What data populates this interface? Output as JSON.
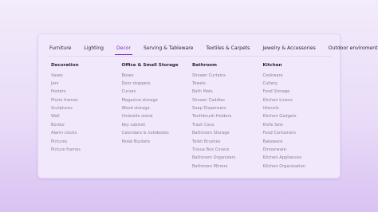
{
  "tabs": [
    {
      "label": "Furniture",
      "active": false
    },
    {
      "label": "Lighting",
      "active": false
    },
    {
      "label": "Decor",
      "active": true
    },
    {
      "label": "Serving & Tableware",
      "active": false
    },
    {
      "label": "Textiles & Carpets",
      "active": false
    },
    {
      "label": "Jewelry & Accessories",
      "active": false
    },
    {
      "label": "Outdoor enviroment",
      "active": false
    }
  ],
  "columns": [
    {
      "title": "Decoration",
      "items": [
        "Vases",
        "Jars",
        "Posters",
        "Photo frames",
        "Sculptures",
        "Wall",
        "Bordur",
        "Alarm clocks",
        "Pictures",
        "Picture frames"
      ]
    },
    {
      "title": "Office & Small Storage",
      "items": [
        "Boxes",
        "Door stoppers",
        "Curves",
        "Magazine storage",
        "Wood storage",
        "Umbrella stand",
        "Key cabinet",
        "Calendars & notebooks",
        "Pedal Buckets"
      ]
    },
    {
      "title": "Bathroom",
      "items": [
        "Shower Curtains",
        "Towels",
        "Bath Mats",
        "Shower Caddies",
        "Soap Dispensers",
        "Toothbrush Holders",
        "Trash Cans",
        "Bathroom Storage",
        "Toilet Brushes",
        "Tissue Box Covers",
        "Bathroom Organizers",
        "Bathroom Mirrors"
      ]
    },
    {
      "title": "Kitchen",
      "items": [
        "Cookware",
        "Cutlery",
        "Food Storage",
        "Kitchen Linens",
        "Utensils",
        "Kitchen Gadgets",
        "Knife Sets",
        "Food Containers",
        "Bakeware",
        "Dinnerware",
        "Kitchen Appliances",
        "Kitchen Organization"
      ]
    }
  ]
}
